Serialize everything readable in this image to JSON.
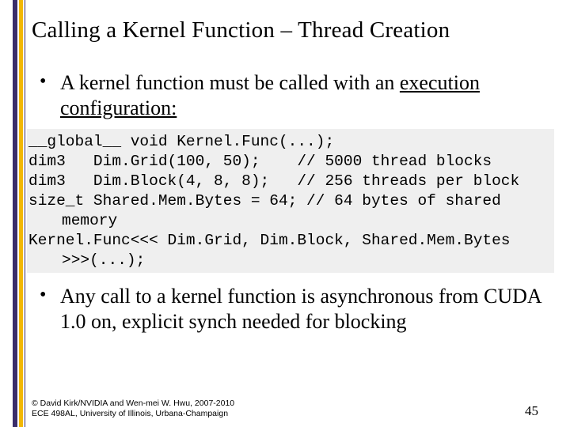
{
  "title": "Calling a Kernel Function – Thread Creation",
  "bullet1_pre": "A kernel function must be called with an ",
  "bullet1_underlined": "execution configuration:",
  "code": {
    "l1": "__global__ void Kernel.Func(...);",
    "l2": "dim3   Dim.Grid(100, 50);    // 5000 thread blocks",
    "l3": "dim3   Dim.Block(4, 8, 8);   // 256 threads per block",
    "l4": "size_t Shared.Mem.Bytes = 64; // 64 bytes of shared",
    "l4b": "memory",
    "l5": "Kernel.Func<<< Dim.Grid, Dim.Block, Shared.Mem.Bytes",
    "l5b": ">>>(...);"
  },
  "bullet2": "Any call to a kernel function is asynchronous from CUDA 1.0 on, explicit synch needed for blocking",
  "footer": {
    "copyright_l1": "© David Kirk/NVIDIA and Wen-mei W. Hwu, 2007-2010",
    "copyright_l2": "ECE 498AL, University of Illinois, Urbana-Champaign",
    "page": "45"
  },
  "accent": {
    "purple": "#3b2e6a",
    "yellow": "#f2b705"
  }
}
